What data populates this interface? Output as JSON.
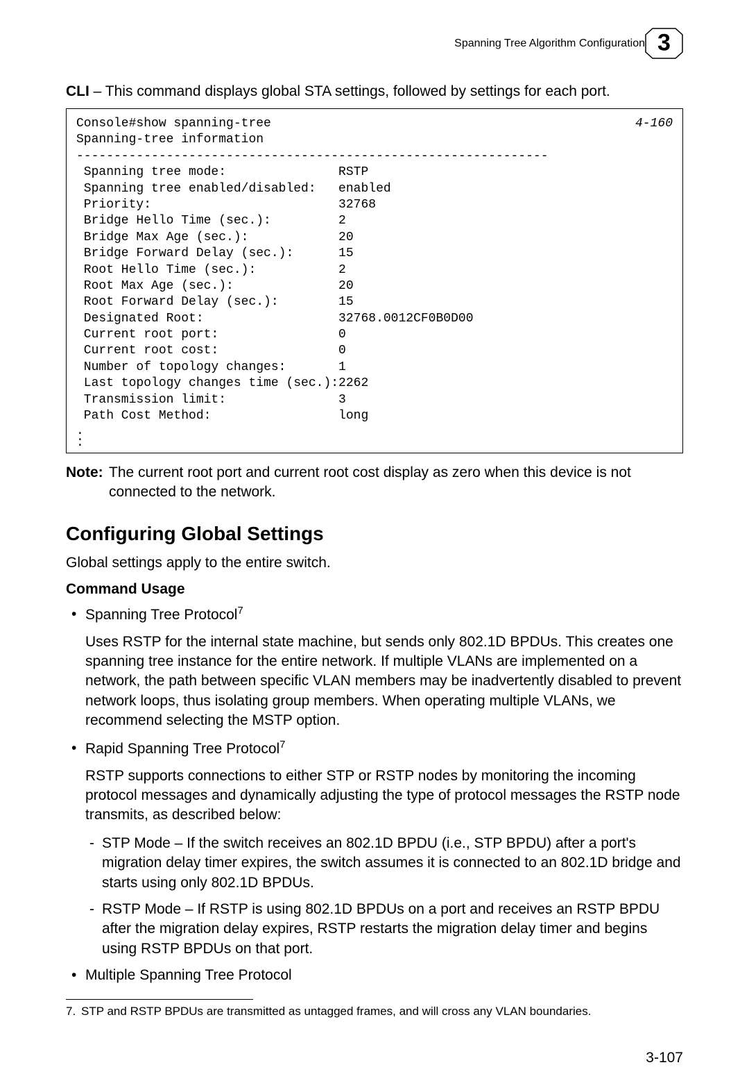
{
  "header": {
    "title": "Spanning Tree Algorithm Configuration",
    "chapter_number": "3"
  },
  "cli_intro": {
    "bold": "CLI",
    "rest": " – This command displays global STA settings, followed by settings for each port."
  },
  "code": {
    "ref": "4-160",
    "body": "Console#show spanning-tree\nSpanning-tree information\n---------------------------------------------------------------\n Spanning tree mode:               RSTP\n Spanning tree enabled/disabled:   enabled\n Priority:                         32768\n Bridge Hello Time (sec.):         2\n Bridge Max Age (sec.):            20\n Bridge Forward Delay (sec.):      15\n Root Hello Time (sec.):           2\n Root Max Age (sec.):              20\n Root Forward Delay (sec.):        15\n Designated Root:                  32768.0012CF0B0D00\n Current root port:                0\n Current root cost:                0\n Number of topology changes:       1\n Last topology changes time (sec.):2262\n Transmission limit:               3\n Path Cost Method:                 long"
  },
  "note": {
    "label": "Note:",
    "text": "The current root port and current root cost display as zero when this device is not connected to the network."
  },
  "section": {
    "heading": "Configuring Global Settings",
    "intro": "Global settings apply to the entire switch.",
    "sub_heading": "Command Usage",
    "b1_title": "Spanning Tree Protocol",
    "b1_sup": "7",
    "b1_para": "Uses RSTP for the internal state machine, but sends only 802.1D BPDUs. This creates one spanning tree instance for the entire network. If multiple VLANs are implemented on a network, the path between specific VLAN members may be inadvertently disabled to prevent network loops, thus isolating group members. When operating multiple VLANs, we recommend selecting the MSTP option.",
    "b2_title": "Rapid Spanning Tree Protocol",
    "b2_sup": "7",
    "b2_para": "RSTP supports connections to either STP or RSTP nodes by monitoring the incoming protocol messages and dynamically adjusting the type of protocol messages the RSTP node transmits, as described below:",
    "dash1": "STP Mode – If the switch receives an 802.1D BPDU (i.e., STP BPDU) after a port's migration delay timer expires, the switch assumes it is connected to an 802.1D bridge and starts using only 802.1D BPDUs.",
    "dash2": "RSTP Mode – If RSTP is using 802.1D BPDUs on a port and receives an RSTP BPDU after the migration delay expires, RSTP restarts the migration delay timer and begins using RSTP BPDUs on that port.",
    "b3_title": "Multiple Spanning Tree Protocol"
  },
  "footnote": {
    "num": "7.",
    "text": "STP and RSTP BPDUs are transmitted as untagged frames, and will cross any VLAN boundaries."
  },
  "page_number": "3-107"
}
